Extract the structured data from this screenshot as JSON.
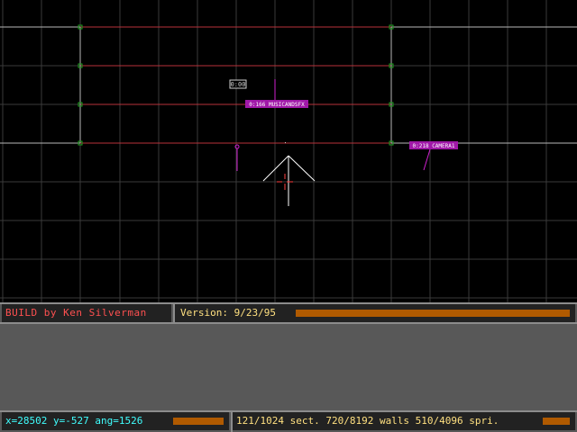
{
  "app": {
    "title": "BUILD by Ken Silverman",
    "version_label": "Version: 9/23/95"
  },
  "map": {
    "sprite_tags": [
      "0:00",
      "0:166 MUSICANDSFX",
      "0:218 CAMERA1"
    ],
    "colors": {
      "grid": "#3a3a3a",
      "white_wall": "#b8b8b8",
      "red_wall": "#b8323a",
      "vertex": "#20a020",
      "sprite": "#d020d0",
      "cursor": "#ff4040"
    }
  },
  "status": {
    "coords": "x=28502 y=-527 ang=1526",
    "stats": "121/1024 sect. 720/8192 walls 510/4096 spri."
  }
}
